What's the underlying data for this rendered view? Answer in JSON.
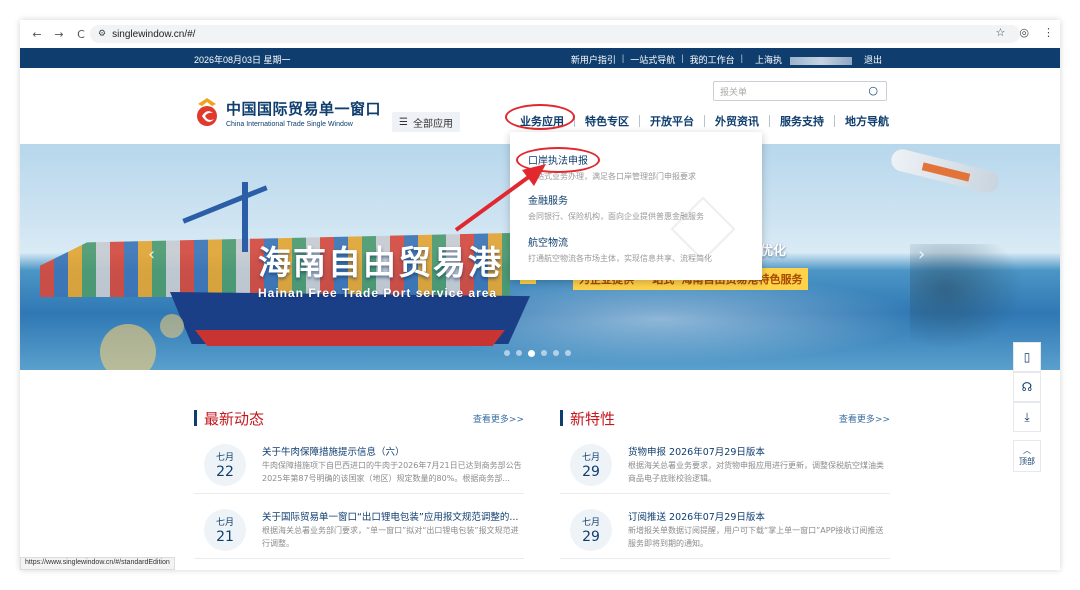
{
  "browser": {
    "url": "singlewindow.cn/#/",
    "back_icon": "←",
    "forward_icon": "→",
    "reload_icon": "C",
    "site_info_icon": "⚙",
    "star_icon": "☆",
    "profile_icon": "◎",
    "menu_icon": "⋮",
    "status_url": "https://www.singlewindow.cn/#/standardEdition"
  },
  "topbar": {
    "date": "2026年08月03日 星期一",
    "links": [
      "新用户指引",
      "一站式导航",
      "我的工作台"
    ],
    "user_prefix": "上海执",
    "logout": "退出"
  },
  "header": {
    "logo_cn": "中国国际贸易单一窗口",
    "logo_en": "China International Trade Single Window",
    "all_apps": "全部应用",
    "search_placeholder": "报关单",
    "nav": [
      "业务应用",
      "特色专区",
      "开放平台",
      "外贸资讯",
      "服务支持",
      "地方导航"
    ]
  },
  "dropdown": {
    "items": [
      {
        "title": "口岸执法申报",
        "desc": "一站式业务办理，满足各口岸管理部门申报要求"
      },
      {
        "title": "金融服务",
        "desc": "会同银行、保险机构，面向企业提供普惠金融服务"
      },
      {
        "title": "航空物流",
        "desc": "打通航空物流各市场主体，实现信息共享、流程简化"
      }
    ]
  },
  "banner": {
    "title": "海南自由贸易港",
    "subtitle": "Hainan Free Trade Port service area",
    "tag": "为企业提供“一站式”海南自由贸易港特色服务",
    "right_text": "优化",
    "prev_icon": "‹",
    "next_icon": "›",
    "slide_count": 6,
    "active_slide": 3
  },
  "news": {
    "title": "最新动态",
    "more": "查看更多>>",
    "items": [
      {
        "month": "七月",
        "day": "22",
        "title": "关于牛肉保障措施提示信息（六）",
        "desc": "牛肉保障措施项下自巴西进口的牛肉于2026年7月21日已达到商务部公告2025年第87号明确的该国家（地区）规定数量的80%。根据商务部..."
      },
      {
        "month": "七月",
        "day": "21",
        "title": "关于国际贸易单一窗口“出口锂电包装”应用报文规范调整的...",
        "desc": "根据海关总署业务部门要求，“单一窗口”拟对“出口锂电包装”报文规范进行调整。"
      }
    ]
  },
  "features": {
    "title": "新特性",
    "more": "查看更多>>",
    "items": [
      {
        "month": "七月",
        "day": "29",
        "title": "货物申报 2026年07月29日版本",
        "desc": "根据海关总署业务要求，对货物申报应用进行更新，调整保税航空煤油类商品电子底账校验逻辑。"
      },
      {
        "month": "七月",
        "day": "29",
        "title": "订阅推送 2026年07月29日版本",
        "desc": "新增报关单数据订阅提醒，用户可下载“掌上单一窗口”APP接收订阅推送服务即将到期的通知。"
      }
    ]
  },
  "tools": {
    "bookmark_icon": "▯",
    "service_icon": "☊",
    "download_icon": "⤓",
    "top_icon": "︿",
    "top_label": "顶部"
  }
}
